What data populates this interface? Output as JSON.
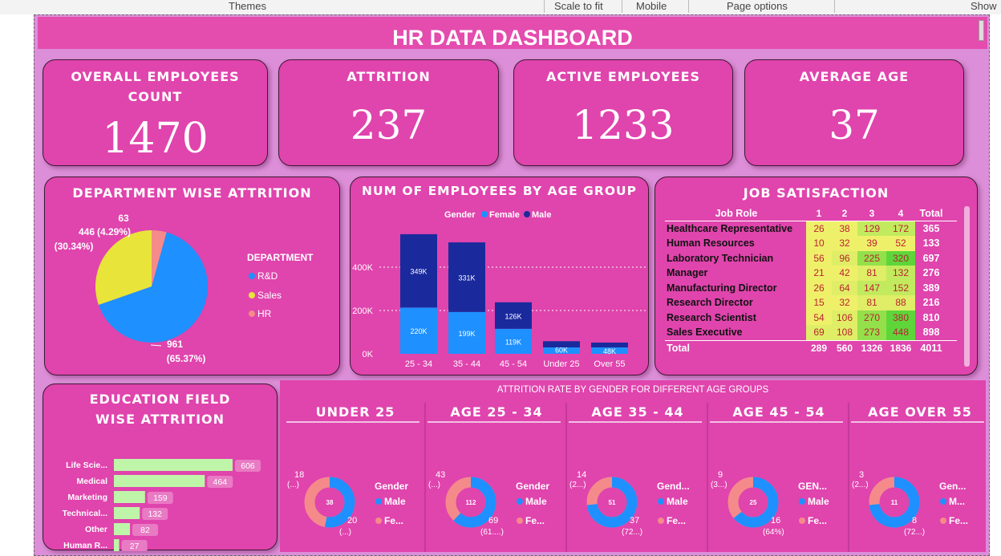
{
  "topbar": {
    "themes": "Themes",
    "scale": "Scale to fit",
    "mobile": "Mobile",
    "page_options": "Page options",
    "show": "Show"
  },
  "title": "HR DATA DASHBOARD",
  "kpis": [
    {
      "label": "OVERALL EMPLOYEES COUNT",
      "value": "1470"
    },
    {
      "label": "ATTRITION",
      "value": "237"
    },
    {
      "label": "ACTIVE EMPLOYEES",
      "value": "1233"
    },
    {
      "label": "AVERAGE AGE",
      "value": "37"
    }
  ],
  "dept": {
    "title": "DEPARTMENT WISE ATTRITION",
    "legend_title": "DEPARTMENT",
    "labels": {
      "hr": "63",
      "hr_pct": "(4.29%)",
      "sales": "446",
      "sales_pct": "(30.34%)",
      "rd": "961",
      "rd_pct": "(65.37%)"
    },
    "legend": [
      "R&D",
      "Sales",
      "HR"
    ]
  },
  "agegroup": {
    "title": "NUM OF EMPLOYEES BY AGE GROUP",
    "legend_title": "Gender",
    "legend": [
      "Female",
      "Male"
    ],
    "yticks": [
      "400K",
      "200K",
      "0K"
    ]
  },
  "jobsat": {
    "title": "JOB SATISFACTION",
    "headers": [
      "Job Role",
      "1",
      "2",
      "3",
      "4",
      "Total"
    ],
    "rows": [
      {
        "role": "Healthcare Representative",
        "v": [
          "26",
          "38",
          "129",
          "172"
        ],
        "t": "365"
      },
      {
        "role": "Human Resources",
        "v": [
          "10",
          "32",
          "39",
          "52"
        ],
        "t": "133"
      },
      {
        "role": "Laboratory Technician",
        "v": [
          "56",
          "96",
          "225",
          "320"
        ],
        "t": "697"
      },
      {
        "role": "Manager",
        "v": [
          "21",
          "42",
          "81",
          "132"
        ],
        "t": "276"
      },
      {
        "role": "Manufacturing Director",
        "v": [
          "26",
          "64",
          "147",
          "152"
        ],
        "t": "389"
      },
      {
        "role": "Research Director",
        "v": [
          "15",
          "32",
          "81",
          "88"
        ],
        "t": "216"
      },
      {
        "role": "Research Scientist",
        "v": [
          "54",
          "106",
          "270",
          "380"
        ],
        "t": "810"
      },
      {
        "role": "Sales Executive",
        "v": [
          "69",
          "108",
          "273",
          "448"
        ],
        "t": "898"
      }
    ],
    "total": {
      "label": "Total",
      "v": [
        "289",
        "560",
        "1326",
        "1836"
      ],
      "t": "4011"
    }
  },
  "education": {
    "title": "EDUCATION FIELD WISE ATTRITION"
  },
  "age_attr": {
    "title": "ATTRITION RATE BY GENDER FOR DIFFERENT AGE GROUPS",
    "groups": [
      {
        "name": "UNDER 25",
        "center": "38",
        "f": "18",
        "fp": "(...)",
        "m": "20",
        "mp": "(...)",
        "legend_title": "Gender",
        "male": "Male",
        "female": "Fe...",
        "mfrac": 0.53
      },
      {
        "name": "AGE 25 - 34",
        "center": "112",
        "f": "43",
        "fp": "(...)",
        "m": "69",
        "mp": "(61....)",
        "legend_title": "Gender",
        "male": "Male",
        "female": "Fe...",
        "mfrac": 0.62
      },
      {
        "name": "AGE 35 - 44",
        "center": "51",
        "f": "14",
        "fp": "(2...)",
        "m": "37",
        "mp": "(72...)",
        "legend_title": "Gend...",
        "male": "Male",
        "female": "Fe...",
        "mfrac": 0.73
      },
      {
        "name": "AGE 45 - 54",
        "center": "25",
        "f": "9",
        "fp": "(3...)",
        "m": "16",
        "mp": "(64%)",
        "legend_title": "GEN...",
        "male": "Male",
        "female": "Fe...",
        "mfrac": 0.64
      },
      {
        "name": "AGE OVER 55",
        "center": "11",
        "f": "3",
        "fp": "(2...)",
        "m": "8",
        "mp": "(72...)",
        "legend_title": "Gen...",
        "male": "M...",
        "female": "Fe...",
        "mfrac": 0.73
      }
    ]
  },
  "colors": {
    "pink": "#e044ad",
    "canvas": "#dc8fd8",
    "female": "#1e90ff",
    "male": "#1a2a9c",
    "sales": "#e8e43a",
    "hr": "#f58a8a",
    "bar_green": "#bff5a8"
  },
  "chart_data": [
    {
      "type": "pie",
      "title": "DEPARTMENT WISE ATTRITION",
      "categories": [
        "R&D",
        "Sales",
        "HR"
      ],
      "values": [
        961,
        446,
        63
      ],
      "percent": [
        65.37,
        30.34,
        4.29
      ]
    },
    {
      "type": "bar",
      "title": "NUM OF EMPLOYEES BY AGE GROUP",
      "categories": [
        "25 - 34",
        "35 - 44",
        "45 - 54",
        "Under 25",
        "Over 55"
      ],
      "series": [
        {
          "name": "Female",
          "values": [
            220,
            199,
            119,
            null,
            null
          ],
          "labels": [
            "220K",
            "199K",
            "119K",
            "",
            ""
          ]
        },
        {
          "name": "Male",
          "values": [
            349,
            331,
            126,
            60,
            48
          ],
          "labels": [
            "349K",
            "331K",
            "126K",
            "60K",
            "48K"
          ]
        }
      ],
      "ylim": [
        0,
        580
      ],
      "ylabel": "",
      "xlabel": ""
    },
    {
      "type": "bar",
      "title": "EDUCATION FIELD WISE ATTRITION",
      "orientation": "horizontal",
      "categories": [
        "Life Scie...",
        "Medical",
        "Marketing",
        "Technical...",
        "Other",
        "Human R..."
      ],
      "values": [
        606,
        464,
        159,
        132,
        82,
        27
      ]
    }
  ]
}
